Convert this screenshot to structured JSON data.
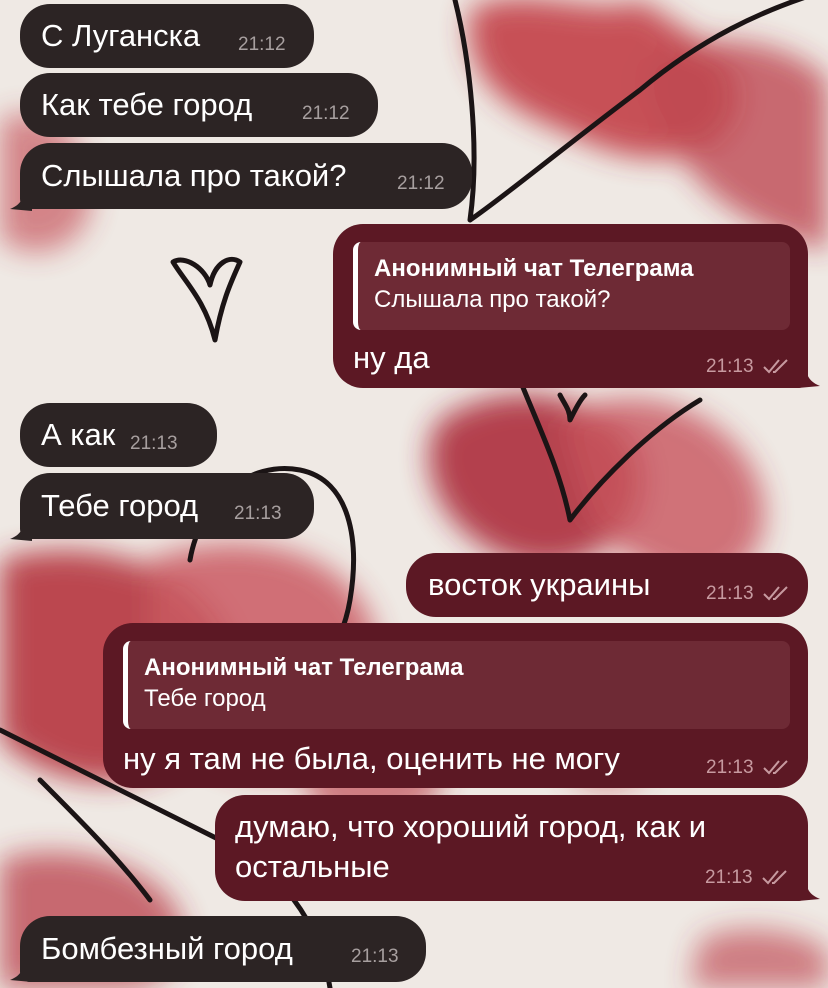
{
  "messages": [
    {
      "side": "in",
      "text": "С Луганска",
      "time": "21:12"
    },
    {
      "side": "in",
      "text": "Как тебе город",
      "time": "21:12"
    },
    {
      "side": "in",
      "text": "Слышала про такой?",
      "time": "21:12"
    },
    {
      "side": "out",
      "reply_author": "Анонимный чат Телеграма",
      "reply_text": "Слышала про такой?",
      "text": "ну да",
      "time": "21:13",
      "status": "read"
    },
    {
      "side": "in",
      "text": "А как",
      "time": "21:13"
    },
    {
      "side": "in",
      "text": "Тебе город",
      "time": "21:13"
    },
    {
      "side": "out",
      "text": "восток украины",
      "time": "21:13",
      "status": "read"
    },
    {
      "side": "out",
      "reply_author": "Анонимный чат Телеграма",
      "reply_text": "Тебе город",
      "text": "ну я там не была, оценить не могу",
      "time": "21:13",
      "status": "read"
    },
    {
      "side": "out",
      "text_line1": "думаю, что хороший город, как и",
      "text_line2": "остальные",
      "time": "21:13",
      "status": "read"
    },
    {
      "side": "in",
      "text": "Бомбезный город",
      "time": "21:13"
    }
  ],
  "colors": {
    "incoming_bubble": "#2c2424",
    "outgoing_bubble": "#5c1824",
    "reply_block": "#6e2a35",
    "wallpaper_accent": "#c0363e"
  },
  "icons": {
    "read_status": "double-check-icon",
    "wallpaper": "hearts-wallpaper"
  }
}
